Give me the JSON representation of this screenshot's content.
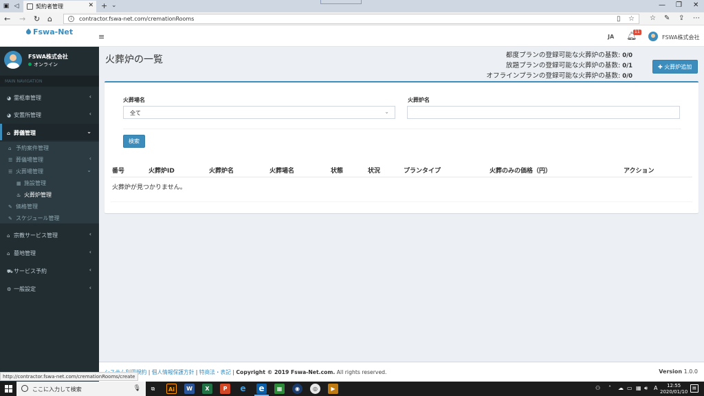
{
  "browser": {
    "tab_title": "契約者管理",
    "url": "contractor.fswa-net.com/cremationRooms",
    "status_url": "http://contractor.fswa-net.com/cremationRooms/create"
  },
  "header": {
    "logo": "Fswa-Net",
    "lang": "JA",
    "notif_count": "11",
    "user": "FSWA株式会社"
  },
  "sidebar": {
    "company": "FSWA株式会社",
    "status": "オンライン",
    "nav_header": "MAIN NAVIGATION",
    "items": [
      {
        "label": "霊柩車管理",
        "icon": "pie-chart-icon"
      },
      {
        "label": "安置所管理",
        "icon": "pie-chart-icon"
      },
      {
        "label": "葬儀管理",
        "icon": "home-icon"
      },
      {
        "label": "宗教サービス管理",
        "icon": "home-icon"
      },
      {
        "label": "墓地管理",
        "icon": "home-icon"
      },
      {
        "label": "サービス予約",
        "icon": "cart-icon"
      },
      {
        "label": "一般設定",
        "icon": "gear-icon"
      }
    ],
    "sub": [
      {
        "label": "予約案件管理"
      },
      {
        "label": "葬儀場管理"
      },
      {
        "label": "火葬場管理"
      },
      {
        "label": "施設管理"
      },
      {
        "label": "火葬炉管理"
      },
      {
        "label": "価格管理"
      },
      {
        "label": "スケジュール管理"
      }
    ]
  },
  "main": {
    "title": "火葬炉の一覧",
    "plan_lines": [
      {
        "label": "都度プランの登録可能な火葬炉の基数:",
        "value": "0/0"
      },
      {
        "label": "放題プランの登録可能な火葬炉の基数:",
        "value": "0/1"
      },
      {
        "label": "オフラインプランの登録可能な火葬炉の基数:",
        "value": "0/0"
      }
    ],
    "add_button": "火葬炉追加",
    "filter": {
      "venue_label": "火葬場名",
      "venue_value": "全て",
      "furnace_label": "火葬炉名",
      "furnace_value": ""
    },
    "search_button": "検索",
    "table": {
      "headers": [
        "番号",
        "火葬炉ID",
        "火葬炉名",
        "火葬場名",
        "状態",
        "状況",
        "プランタイプ",
        "火葬のみの価格（円）",
        "アクション"
      ],
      "empty": "火葬炉が見つかりません。"
    }
  },
  "footer": {
    "link1": "システム利用規約",
    "link2": "個人情報保護方針",
    "link3": "特商法・表記",
    "copyright": "Copyright © 2019 Fswa-Net.com.",
    "rights": "All rights reserved.",
    "version_label": "Version",
    "version": "1.0.0"
  },
  "taskbar": {
    "search_placeholder": "ここに入力して検索",
    "time": "12:55",
    "date": "2020/01/10"
  }
}
